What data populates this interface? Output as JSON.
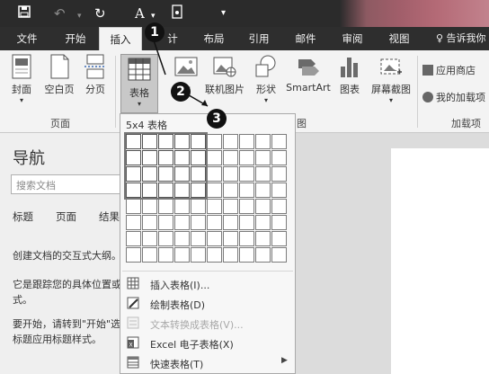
{
  "title_bar": {
    "save_icon": "save-icon",
    "undo_icon": "undo-icon",
    "redo_icon": "redo-icon",
    "font_icon": "A",
    "touch_icon": "touch-mode-icon"
  },
  "tabs": [
    {
      "label": "文件",
      "active": false
    },
    {
      "label": "开始",
      "active": false
    },
    {
      "label": "插入",
      "active": true
    },
    {
      "label": "计",
      "active": false
    },
    {
      "label": "布局",
      "active": false
    },
    {
      "label": "引用",
      "active": false
    },
    {
      "label": "邮件",
      "active": false
    },
    {
      "label": "审阅",
      "active": false
    },
    {
      "label": "视图",
      "active": false
    }
  ],
  "tell_me": "♀ 告诉我你",
  "ribbon": {
    "pages_group": {
      "label": "页面",
      "buttons": [
        {
          "label": "封面",
          "has_dropdown": true
        },
        {
          "label": "空白页"
        },
        {
          "label": "分页"
        }
      ]
    },
    "table_button": {
      "label": "表格"
    },
    "illustrations_group": {
      "label": "图",
      "buttons": [
        {
          "label": "片"
        },
        {
          "label": "联机图片"
        },
        {
          "label": "形状"
        },
        {
          "label": "SmartArt"
        },
        {
          "label": "图表"
        },
        {
          "label": "屏幕截图"
        }
      ]
    },
    "addins_group": {
      "label": "加载项",
      "items": [
        {
          "label": "应用商店"
        },
        {
          "label": "我的加载项"
        }
      ]
    }
  },
  "nav_pane": {
    "title": "导航",
    "search_placeholder": "搜索文档",
    "tabs": [
      "标题",
      "页面",
      "结果"
    ],
    "paragraphs": [
      "创建文档的交互式大纲。",
      "它是跟踪您的具体位置或",
      "式。",
      "要开始，请转到\"开始\"选",
      "标题应用标题样式。"
    ]
  },
  "table_menu": {
    "grid_title": "5x4 表格",
    "columns": 10,
    "rows": 8,
    "selected_columns": 5,
    "selected_rows": 4,
    "items": [
      {
        "label": "插入表格(I)...",
        "icon": "insert-table-icon",
        "disabled": false,
        "submenu": false
      },
      {
        "label": "绘制表格(D)",
        "icon": "draw-table-icon",
        "disabled": false,
        "submenu": false
      },
      {
        "label": "文本转换成表格(V)...",
        "icon": "text-to-table-icon",
        "disabled": true,
        "submenu": false
      },
      {
        "label": "Excel 电子表格(X)",
        "icon": "excel-icon",
        "disabled": false,
        "submenu": false
      },
      {
        "label": "快速表格(T)",
        "icon": "quick-tables-icon",
        "disabled": false,
        "submenu": true
      }
    ]
  },
  "callouts": [
    "1",
    "2",
    "3"
  ]
}
